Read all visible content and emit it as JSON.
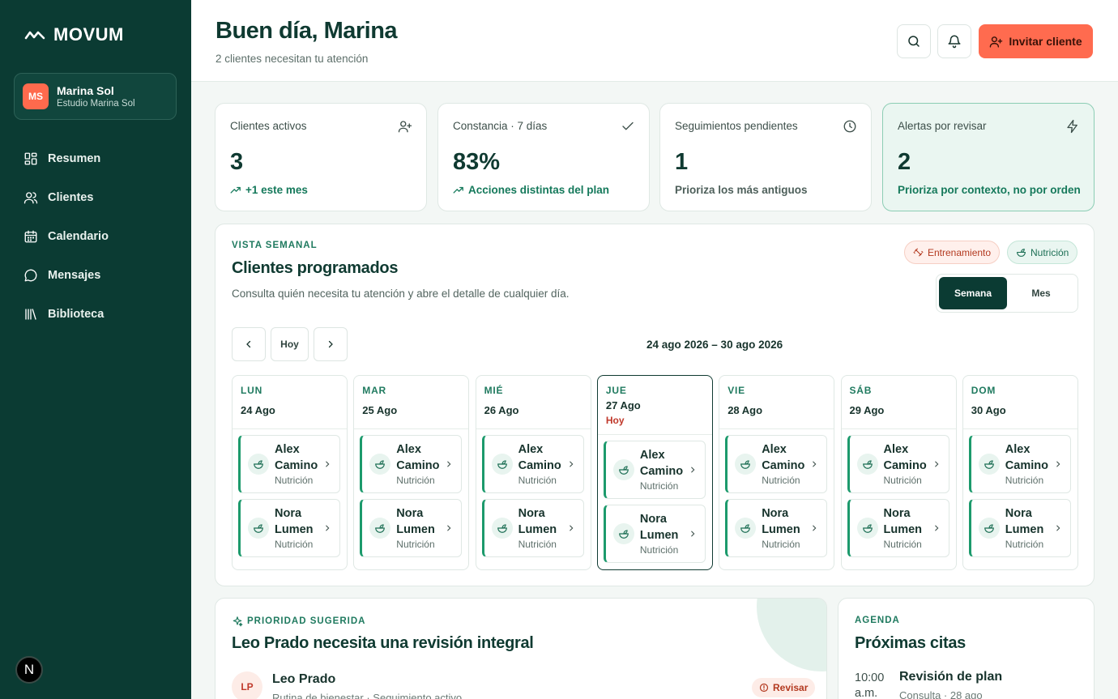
{
  "brand": {
    "name": "MOVUM"
  },
  "user": {
    "initials": "MS",
    "name": "Marina Sol",
    "studio": "Estudio Marina Sol"
  },
  "nav": [
    {
      "label": "Resumen",
      "icon": "dashboard-icon"
    },
    {
      "label": "Clientes",
      "icon": "users-icon"
    },
    {
      "label": "Calendario",
      "icon": "calendar-icon"
    },
    {
      "label": "Mensajes",
      "icon": "message-icon"
    },
    {
      "label": "Biblioteca",
      "icon": "library-icon"
    }
  ],
  "dev_badge": "N",
  "header": {
    "greeting": "Buen día, Marina",
    "subtitle": "2 clientes necesitan tu atención",
    "invite_label": "Invitar cliente"
  },
  "stats": [
    {
      "label": "Clientes activos",
      "value": "3",
      "note": "+1 este mes",
      "icon": "user-plus-icon"
    },
    {
      "label": "Constancia · 7 días",
      "value": "83%",
      "note": "Acciones distintas del plan",
      "icon": "check-icon"
    },
    {
      "label": "Seguimientos pendientes",
      "value": "1",
      "note": "Prioriza los más antiguos",
      "icon": "clock-icon"
    },
    {
      "label": "Alertas por revisar",
      "value": "2",
      "note": "Prioriza por contexto, no por orden",
      "icon": "bolt-icon"
    }
  ],
  "week": {
    "eyebrow": "VISTA SEMANAL",
    "title": "Clientes programados",
    "description": "Consulta quién necesita tu atención y abre el detalle de cualquier día.",
    "legend": {
      "training": "Entrenamiento",
      "nutrition": "Nutrición"
    },
    "toggle": {
      "week": "Semana",
      "month": "Mes"
    },
    "today_label": "Hoy",
    "range": "24 ago 2026 – 30 ago 2026",
    "days": [
      {
        "name": "LUN",
        "date": "24 Ago",
        "today": "",
        "appts": [
          {
            "name": "Alex Camino",
            "type": "Nutrición"
          },
          {
            "name": "Nora Lumen",
            "type": "Nutrición"
          }
        ]
      },
      {
        "name": "MAR",
        "date": "25 Ago",
        "today": "",
        "appts": [
          {
            "name": "Alex Camino",
            "type": "Nutrición"
          },
          {
            "name": "Nora Lumen",
            "type": "Nutrición"
          }
        ]
      },
      {
        "name": "MIÉ",
        "date": "26 Ago",
        "today": "",
        "appts": [
          {
            "name": "Alex Camino",
            "type": "Nutrición"
          },
          {
            "name": "Nora Lumen",
            "type": "Nutrición"
          }
        ]
      },
      {
        "name": "JUE",
        "date": "27 Ago",
        "today": "Hoy",
        "appts": [
          {
            "name": "Alex Camino",
            "type": "Nutrición"
          },
          {
            "name": "Nora Lumen",
            "type": "Nutrición"
          }
        ]
      },
      {
        "name": "VIE",
        "date": "28 Ago",
        "today": "",
        "appts": [
          {
            "name": "Alex Camino",
            "type": "Nutrición"
          },
          {
            "name": "Nora Lumen",
            "type": "Nutrición"
          }
        ]
      },
      {
        "name": "SÁB",
        "date": "29 Ago",
        "today": "",
        "appts": [
          {
            "name": "Alex Camino",
            "type": "Nutrición"
          },
          {
            "name": "Nora Lumen",
            "type": "Nutrición"
          }
        ]
      },
      {
        "name": "DOM",
        "date": "30 Ago",
        "today": "",
        "appts": [
          {
            "name": "Alex Camino",
            "type": "Nutrición"
          },
          {
            "name": "Nora Lumen",
            "type": "Nutrición"
          }
        ]
      }
    ]
  },
  "priority": {
    "eyebrow": "PRIORIDAD SUGERIDA",
    "title": "Leo Prado necesita una revisión integral",
    "initials": "LP",
    "name": "Leo Prado",
    "subtitle": "Rutina de bienestar · Seguimiento activo",
    "badge": "Revisar"
  },
  "agenda": {
    "eyebrow": "AGENDA",
    "title": "Próximas citas",
    "time": "10:00 a.m.",
    "event": "Revisión de plan",
    "event_sub": "Consulta · 28 ago"
  },
  "colors": {
    "sidebar": "#0b3b33",
    "accent": "#ff6b4f",
    "green": "#1c9a6c",
    "today": "#c0392b"
  }
}
